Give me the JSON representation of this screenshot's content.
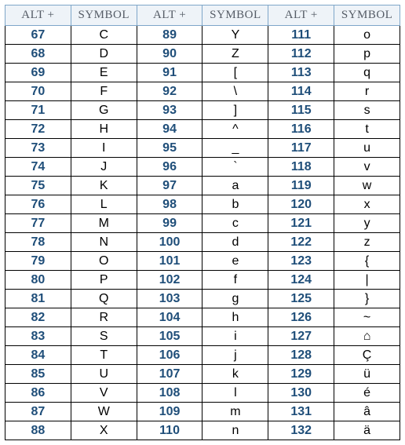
{
  "headers": {
    "alt": "ALT +",
    "symbol": "SYMBOL"
  },
  "columns": [
    [
      {
        "alt": "67",
        "sym": "C"
      },
      {
        "alt": "68",
        "sym": "D"
      },
      {
        "alt": "69",
        "sym": "E"
      },
      {
        "alt": "70",
        "sym": "F"
      },
      {
        "alt": "71",
        "sym": "G"
      },
      {
        "alt": "72",
        "sym": "H"
      },
      {
        "alt": "73",
        "sym": "I"
      },
      {
        "alt": "74",
        "sym": "J"
      },
      {
        "alt": "75",
        "sym": "K"
      },
      {
        "alt": "76",
        "sym": "L"
      },
      {
        "alt": "77",
        "sym": "M"
      },
      {
        "alt": "78",
        "sym": "N"
      },
      {
        "alt": "79",
        "sym": "O"
      },
      {
        "alt": "80",
        "sym": "P"
      },
      {
        "alt": "81",
        "sym": "Q"
      },
      {
        "alt": "82",
        "sym": "R"
      },
      {
        "alt": "83",
        "sym": "S"
      },
      {
        "alt": "84",
        "sym": "T"
      },
      {
        "alt": "85",
        "sym": "U"
      },
      {
        "alt": "86",
        "sym": "V"
      },
      {
        "alt": "87",
        "sym": "W"
      },
      {
        "alt": "88",
        "sym": "X"
      }
    ],
    [
      {
        "alt": "89",
        "sym": "Y"
      },
      {
        "alt": "90",
        "sym": "Z"
      },
      {
        "alt": "91",
        "sym": "["
      },
      {
        "alt": "92",
        "sym": "\\"
      },
      {
        "alt": "93",
        "sym": "]"
      },
      {
        "alt": "94",
        "sym": "^"
      },
      {
        "alt": "95",
        "sym": "_"
      },
      {
        "alt": "96",
        "sym": "`"
      },
      {
        "alt": "97",
        "sym": "a"
      },
      {
        "alt": "98",
        "sym": "b"
      },
      {
        "alt": "99",
        "sym": "c"
      },
      {
        "alt": "100",
        "sym": "d"
      },
      {
        "alt": "101",
        "sym": "e"
      },
      {
        "alt": "102",
        "sym": "f"
      },
      {
        "alt": "103",
        "sym": "g"
      },
      {
        "alt": "104",
        "sym": "h"
      },
      {
        "alt": "105",
        "sym": "i"
      },
      {
        "alt": "106",
        "sym": "j"
      },
      {
        "alt": "107",
        "sym": "k"
      },
      {
        "alt": "108",
        "sym": "l"
      },
      {
        "alt": "109",
        "sym": "m"
      },
      {
        "alt": "110",
        "sym": "n"
      }
    ],
    [
      {
        "alt": "111",
        "sym": "o"
      },
      {
        "alt": "112",
        "sym": "p"
      },
      {
        "alt": "113",
        "sym": "q"
      },
      {
        "alt": "114",
        "sym": "r"
      },
      {
        "alt": "115",
        "sym": "s"
      },
      {
        "alt": "116",
        "sym": "t"
      },
      {
        "alt": "117",
        "sym": "u"
      },
      {
        "alt": "118",
        "sym": "v"
      },
      {
        "alt": "119",
        "sym": "w"
      },
      {
        "alt": "120",
        "sym": "x"
      },
      {
        "alt": "121",
        "sym": "y"
      },
      {
        "alt": "122",
        "sym": "z"
      },
      {
        "alt": "123",
        "sym": "{"
      },
      {
        "alt": "124",
        "sym": "|"
      },
      {
        "alt": "125",
        "sym": "}"
      },
      {
        "alt": "126",
        "sym": "~"
      },
      {
        "alt": "127",
        "sym": "⌂"
      },
      {
        "alt": "128",
        "sym": "Ç"
      },
      {
        "alt": "129",
        "sym": "ü"
      },
      {
        "alt": "130",
        "sym": "é"
      },
      {
        "alt": "131",
        "sym": "â"
      },
      {
        "alt": "132",
        "sym": "ä"
      }
    ]
  ]
}
